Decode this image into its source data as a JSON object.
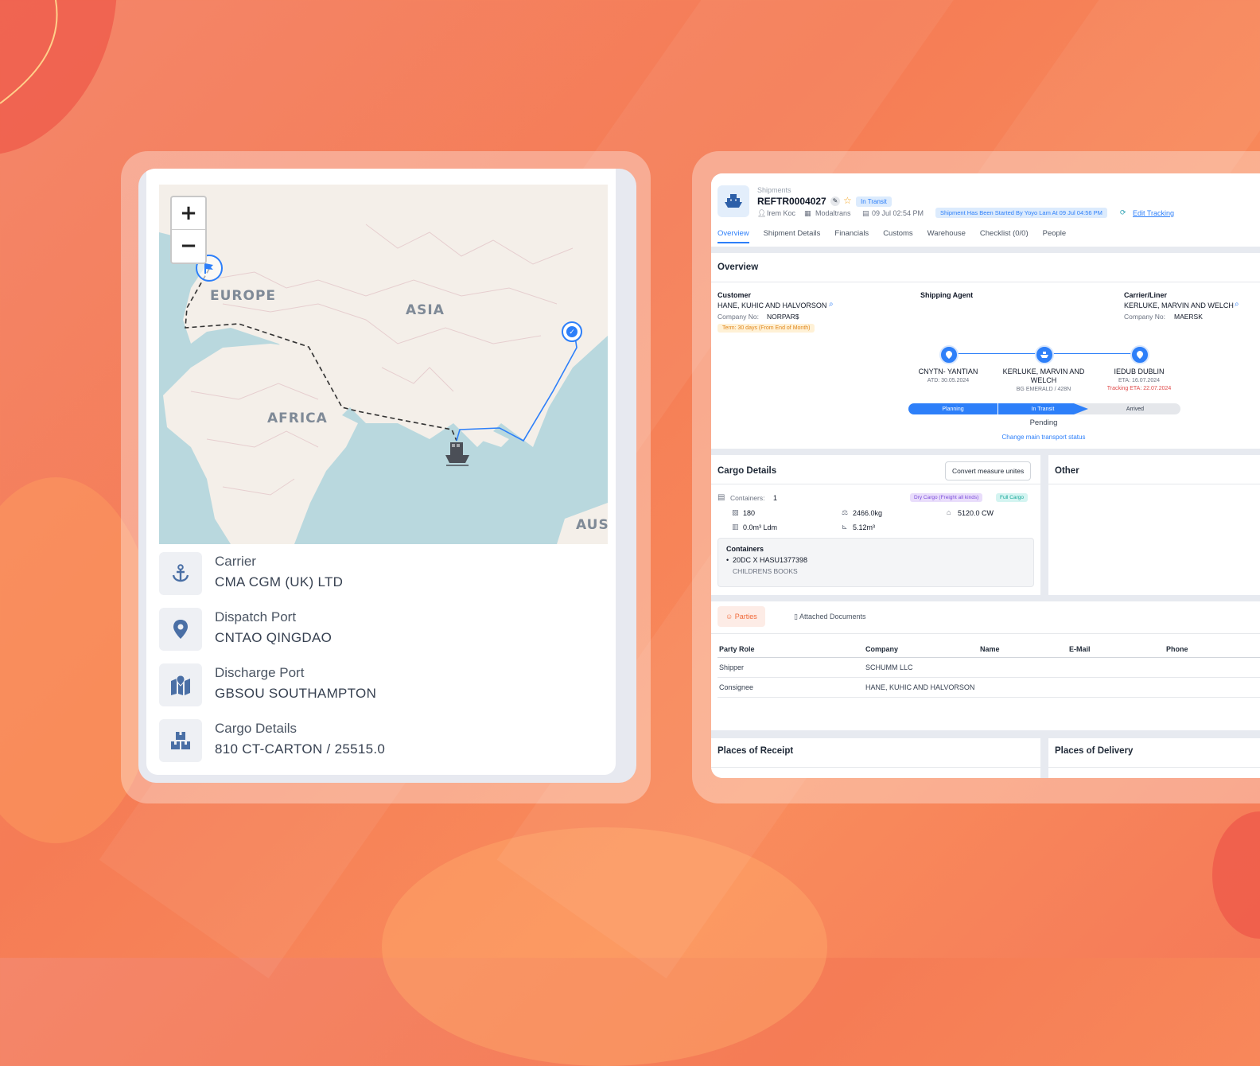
{
  "map_panel": {
    "zoom_in": "+",
    "zoom_out": "−",
    "labels": [
      "EUROPE",
      "ASIA",
      "AFRICA",
      "AUS"
    ],
    "details": [
      {
        "label": "Carrier",
        "value": "CMA CGM (UK) LTD",
        "icon": "anchor-icon"
      },
      {
        "label": "Dispatch Port",
        "value": "CNTAO QINGDAO",
        "icon": "map-pin-icon"
      },
      {
        "label": "Discharge Port",
        "value": "GBSOU SOUTHAMPTON",
        "icon": "map-location-icon"
      },
      {
        "label": "Cargo Details",
        "value": "810 CT-CARTON / 25515.0",
        "icon": "boxes-icon"
      }
    ]
  },
  "shipment": {
    "breadcrumb": "Shipments",
    "ref": "REFTR0004027",
    "status_badge": "In Transit",
    "user": "Irem Koc",
    "company": "Modaltrans",
    "date": "09 Jul 02:54 PM",
    "started_banner": "Shipment Has Been Started By Yoyo Lam At 09 Jul 04:56 PM",
    "edit_tracking": "Edit Tracking",
    "tabs": [
      "Overview",
      "Shipment Details",
      "Financials",
      "Customs",
      "Warehouse",
      "Checklist (0/0)",
      "People"
    ]
  },
  "overview": {
    "title": "Overview",
    "customer_label": "Customer",
    "customer_name": "HANE, KUHIC AND HALVORSON",
    "customer_company_no": "Company No:",
    "customer_company_val": "NORPAR$",
    "term": "Term: 30 days (From End of Month)",
    "shipping_agent_label": "Shipping Agent",
    "carrier_label": "Carrier/Liner",
    "carrier_name": "KERLUKE, MARVIN AND WELCH",
    "carrier_company_no": "Company No:",
    "carrier_company_val": "MAERSK",
    "route": [
      {
        "name": "CNYTN- YANTIAN",
        "sub": "ATD: 30.05.2024",
        "sub2": ""
      },
      {
        "name": "KERLUKE, MARVIN AND WELCH",
        "sub": "BG EMERALD / 428N",
        "sub2": ""
      },
      {
        "name": "IEDUB DUBLIN",
        "sub": "ETA: 16.07.2024",
        "sub2": "Tracking ETA: 22.07.2024"
      }
    ],
    "stages": [
      "Planning",
      "In Transit",
      "Arrived"
    ],
    "pending": "Pending",
    "change_status": "Change main transport status"
  },
  "cargo": {
    "title": "Cargo Details",
    "convert_btn": "Convert measure unites",
    "containers_label": "Containers:",
    "containers_count": "1",
    "tag1": "Dry Cargo (Freight all kinds)",
    "tag2": "Full Cargo",
    "packages": "180",
    "weight": "2466.0kg",
    "cw": "5120.0 CW",
    "ldm": "0.0m³ Ldm",
    "volume": "5.12m³",
    "containers_box_title": "Containers",
    "container_item": "20DC X HASU1377398",
    "container_desc": "CHILDRENS BOOKS"
  },
  "other": {
    "title": "Other"
  },
  "parties": {
    "tab_parties": "Parties",
    "tab_docs": "Attached Documents",
    "columns": [
      "Party Role",
      "Company",
      "Name",
      "E-Mail",
      "Phone"
    ],
    "rows": [
      [
        "Shipper",
        "SCHUMM LLC",
        "",
        "",
        ""
      ],
      [
        "Consignee",
        "HANE, KUHIC AND HALVORSON",
        "",
        "",
        ""
      ]
    ]
  },
  "places": {
    "receipt": "Places of Receipt",
    "delivery": "Places of Delivery"
  },
  "colors": {
    "accent": "#2d7ff9",
    "background": "#f57c55",
    "tag_purple": "#e9ddfb",
    "tag_teal": "#d4f4f1",
    "term_bg": "#fff1d6"
  }
}
